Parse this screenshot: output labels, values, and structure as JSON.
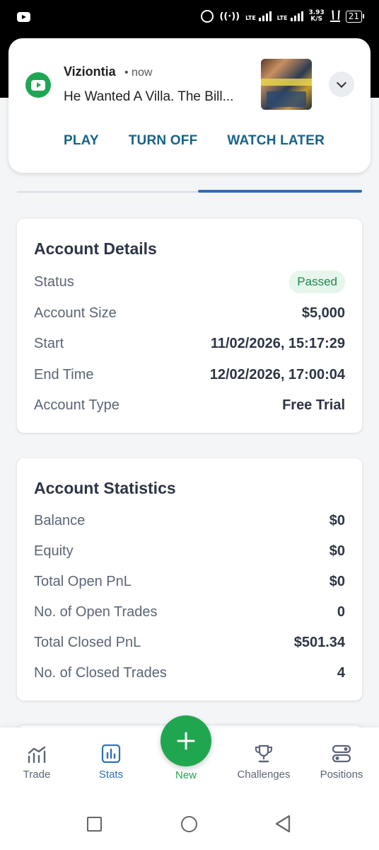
{
  "status_bar": {
    "network_1": "LTE",
    "network_2": "LTE",
    "speed_value": "3.93",
    "speed_unit": "K/S",
    "battery": "21"
  },
  "notification": {
    "app_name": "Viziontia",
    "time": "• now",
    "text": "He Wanted A Villa. The Bill...",
    "actions": [
      "PLAY",
      "TURN OFF",
      "WATCH LATER"
    ]
  },
  "account_details": {
    "title": "Account Details",
    "status_label": "Status",
    "status_value": "Passed",
    "size_label": "Account Size",
    "size_value": "$5,000",
    "start_label": "Start",
    "start_value": "11/02/2026, 15:17:29",
    "end_label": "End Time",
    "end_value": "12/02/2026, 17:00:04",
    "type_label": "Account Type",
    "type_value": "Free Trial"
  },
  "account_statistics": {
    "title": "Account Statistics",
    "rows": [
      {
        "label": "Balance",
        "value": "$0"
      },
      {
        "label": "Equity",
        "value": "$0"
      },
      {
        "label": "Total Open PnL",
        "value": "$0"
      },
      {
        "label": "No. of Open Trades",
        "value": "0"
      },
      {
        "label": "Total Closed PnL",
        "value": "$501.34"
      },
      {
        "label": "No. of Closed Trades",
        "value": "4"
      }
    ]
  },
  "bottom_nav": {
    "trade": "Trade",
    "stats": "Stats",
    "new": "New",
    "challenges": "Challenges",
    "positions": "Positions",
    "active_color": "#2f6fb9",
    "fab_color": "#21a650"
  }
}
